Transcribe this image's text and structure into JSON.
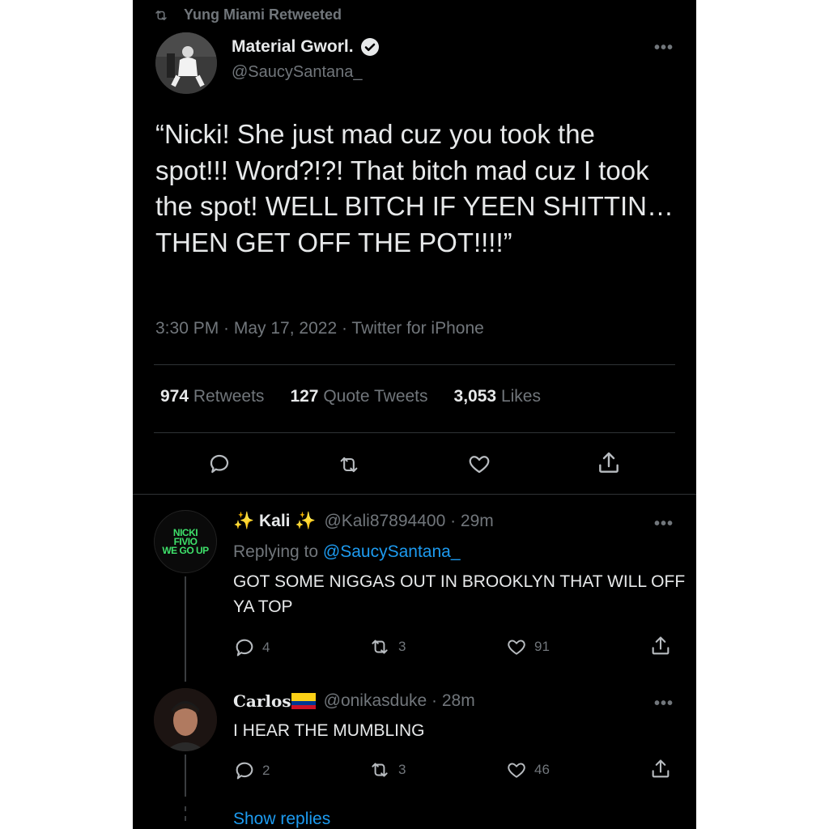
{
  "retweet_banner": {
    "icon": "retweet-icon",
    "text": "Yung Miami Retweeted"
  },
  "main_tweet": {
    "display_name": "Material Gworl.",
    "handle": "@SaucySantana_",
    "text": "“Nicki! She just mad cuz you took the spot!!! Word?!?! That bitch mad cuz I took the spot! WELL BITCH IF YEEN SHITTIN… THEN GET OFF THE POT!!!!”",
    "timestamp": "3:30 PM · May 17, 2022 · Twitter for iPhone",
    "stats": {
      "retweets_count": "974",
      "retweets_label": "Retweets",
      "quotes_count": "127",
      "quotes_label": "Quote Tweets",
      "likes_count": "3,053",
      "likes_label": "Likes"
    }
  },
  "replies": [
    {
      "display_name": "✨ Kali ✨",
      "handle_time": "@Kali87894400 · 29m",
      "replying_prefix": "Replying to",
      "replying_to": "@SaucySantana_",
      "avatar_text": [
        "NICKI",
        "FIVIO",
        "WE GO UP"
      ],
      "text": "GOT SOME NIGGAS OUT IN BROOKLYN THAT WILL OFF YA TOP",
      "reply_count": "4",
      "retweet_count": "3",
      "like_count": "91"
    },
    {
      "display_name": "Carlos",
      "flag": "🇨🇴",
      "handle_time": "@onikasduke · 28m",
      "text": "I HEAR THE MUMBLING",
      "reply_count": "2",
      "retweet_count": "3",
      "like_count": "46"
    }
  ],
  "show_replies": "Show replies",
  "colors": {
    "background": "#000000",
    "text": "#e7e9ea",
    "muted": "#71767b",
    "link": "#1d9bf0",
    "divider": "#2f3336",
    "avatar_green": "#3ee06a"
  }
}
